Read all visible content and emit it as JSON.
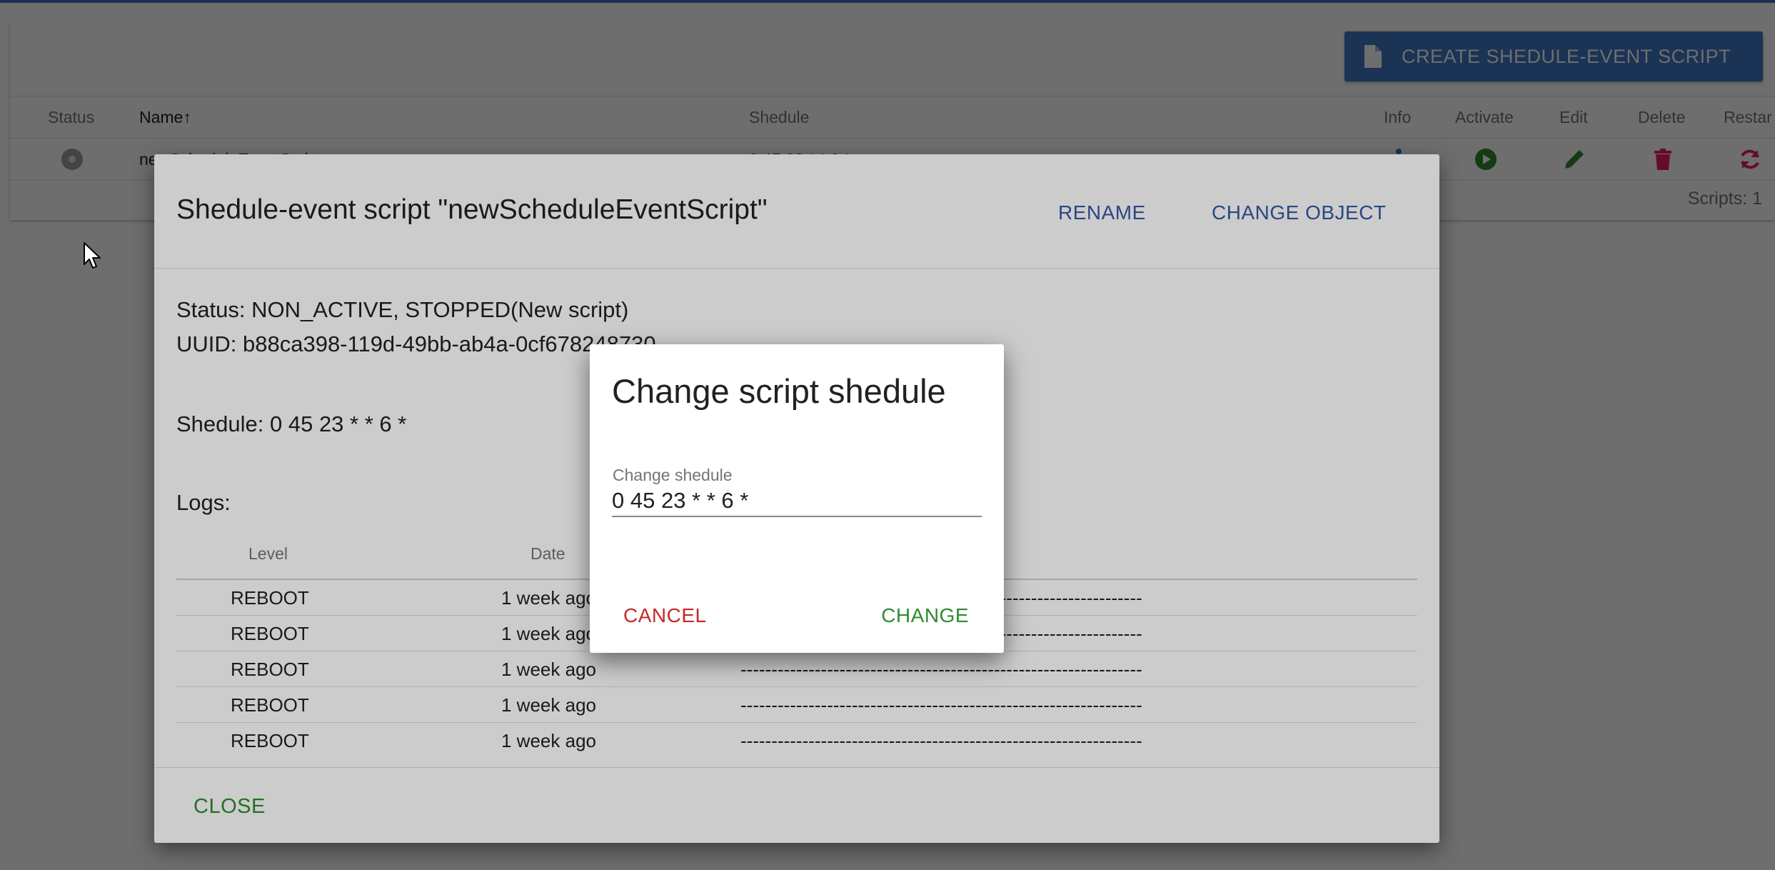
{
  "page": {
    "create_button_label": "CREATE SHEDULE-EVENT SCRIPT",
    "columns": {
      "status": "Status",
      "name": "Name",
      "sort_arrow": "↑",
      "shedule": "Shedule",
      "info": "Info",
      "activate": "Activate",
      "edit": "Edit",
      "delete": "Delete",
      "restart": "Restar"
    },
    "row": {
      "name": "newScheduleEventScript",
      "shedule": "0 45 23 * * 6 *"
    },
    "scripts_count": "Scripts: 1"
  },
  "dialog": {
    "title": "Shedule-event script \"newScheduleEventScript\"",
    "rename_label": "RENAME",
    "change_object_label": "CHANGE OBJECT",
    "status_line": "Status: NON_ACTIVE, STOPPED(New script)",
    "uuid_line": "UUID: b88ca398-119d-49bb-ab4a-0cf678248730",
    "shedule_line": "Shedule: 0 45 23 * * 6 *",
    "logs_label": "Logs:",
    "log_columns": {
      "level": "Level",
      "date": "Date"
    },
    "logs": [
      {
        "level": "REBOOT",
        "date": "1 week ago",
        "message": "-----------------------------------------------------------------"
      },
      {
        "level": "REBOOT",
        "date": "1 week ago",
        "message": "-----------------------------------------------------------------"
      },
      {
        "level": "REBOOT",
        "date": "1 week ago",
        "message": "-----------------------------------------------------------------"
      },
      {
        "level": "REBOOT",
        "date": "1 week ago",
        "message": "-----------------------------------------------------------------"
      },
      {
        "level": "REBOOT",
        "date": "1 week ago",
        "message": "-----------------------------------------------------------------"
      }
    ],
    "close_label": "CLOSE"
  },
  "modal": {
    "title": "Change script shedule",
    "field_label": "Change shedule",
    "field_value": "0 45 23 * * 6 *",
    "cancel_label": "CANCEL",
    "change_label": "CHANGE"
  },
  "colors": {
    "primary_blue": "#3f77c6",
    "link_blue": "#3558a8",
    "green": "#2f8a2f",
    "red": "#c62828",
    "delete_pink": "#e91e63"
  },
  "icons": [
    "document-icon",
    "sort-up-icon",
    "info-icon",
    "play-icon",
    "pencil-icon",
    "trash-icon",
    "restart-icon",
    "cursor-icon"
  ]
}
